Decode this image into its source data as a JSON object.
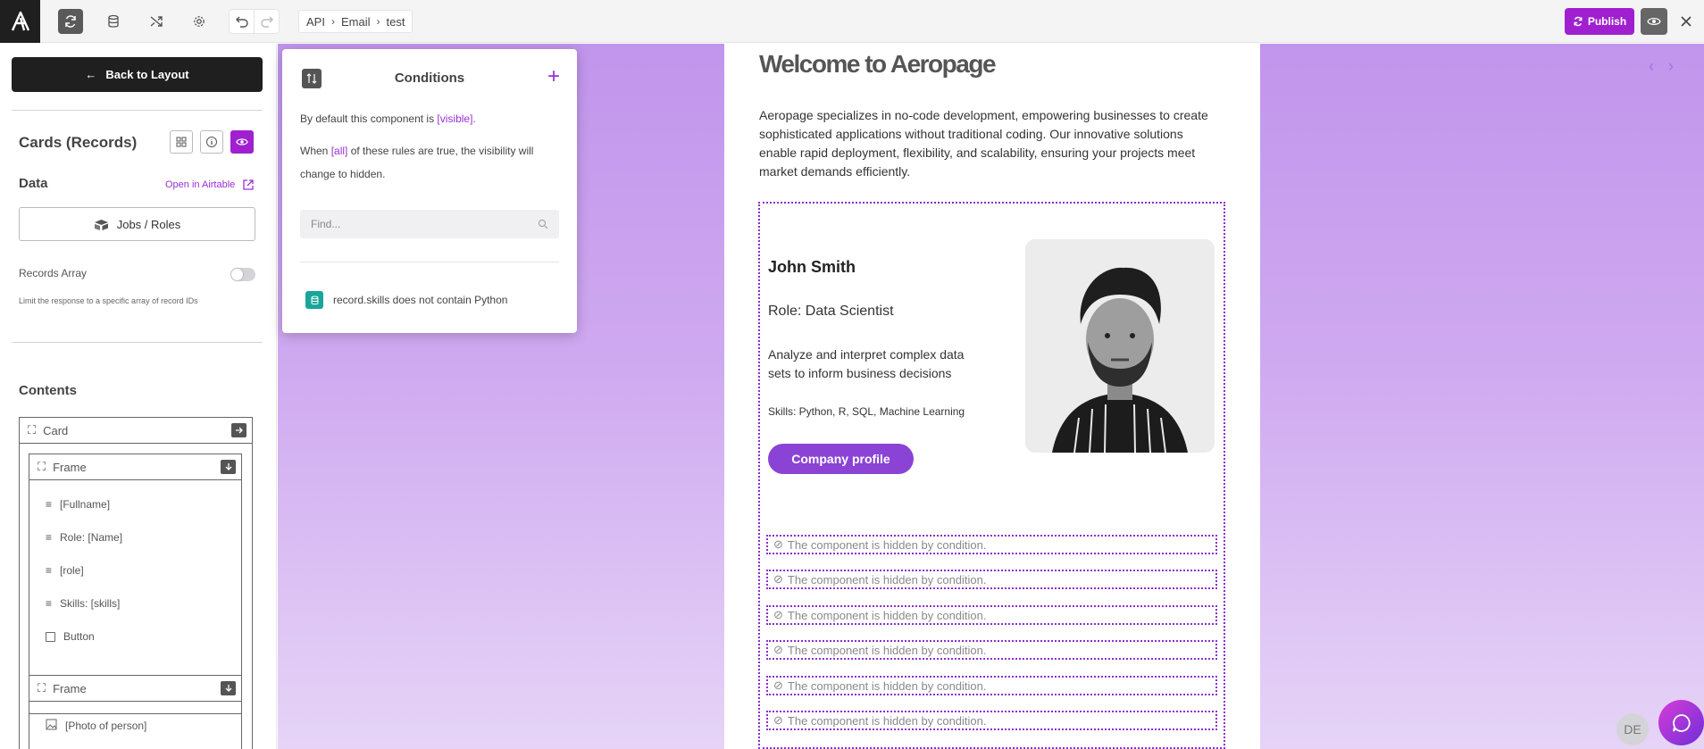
{
  "topbar": {
    "logo": "aeropage-logo",
    "toolbar_icons": [
      "sync-icon",
      "database-icon",
      "shuffle-icon",
      "gear-icon",
      "undo-icon",
      "redo-icon"
    ],
    "breadcrumb": [
      "API",
      "Email",
      "test"
    ],
    "publish_label": "Publish",
    "accent": "#a020d0"
  },
  "sidebar": {
    "back_label": "Back to Layout",
    "component_title": "Cards (Records)",
    "data_label": "Data",
    "open_airtable": "Open in Airtable",
    "table_name": "Jobs / Roles",
    "records_array_label": "Records Array",
    "records_array_enabled": false,
    "records_array_hint": "Limit the response to a specific array of record IDs",
    "contents_label": "Contents",
    "tree": {
      "card": "Card",
      "frame1": "Frame",
      "frame1_items": [
        "[Fullname]",
        "Role: [Name]",
        "[role]",
        "Skills: [skills]",
        "Button"
      ],
      "frame2": "Frame",
      "frame2_items": [
        "[Photo of person]"
      ]
    }
  },
  "conditions": {
    "title": "Conditions",
    "default_prefix": "By default this component is ",
    "default_value": "[visible].",
    "when_prefix": "When ",
    "when_value": "[all]",
    "when_suffix": " of these rules are true, the visibility will change to hidden.",
    "find_placeholder": "Find...",
    "rules": [
      "record.skills does not contain Python"
    ]
  },
  "preview": {
    "heading": "Welcome to Aeropage",
    "intro": "Aeropage specializes in no-code development, empowering businesses to create sophisticated applications without traditional coding. Our innovative solutions enable rapid deployment, flexibility, and scalability, ensuring your projects meet market demands efficiently.",
    "card": {
      "name": "John Smith",
      "role": "Role: Data Scientist",
      "description": "Analyze and interpret complex data sets to inform business decisions",
      "skills": "Skills: Python, R, SQL, Machine Learning",
      "button": "Company profile"
    },
    "hidden_message": "The component is hidden by condition.",
    "hidden_count": 6
  },
  "footer": {
    "avatar_initials": "DE"
  }
}
